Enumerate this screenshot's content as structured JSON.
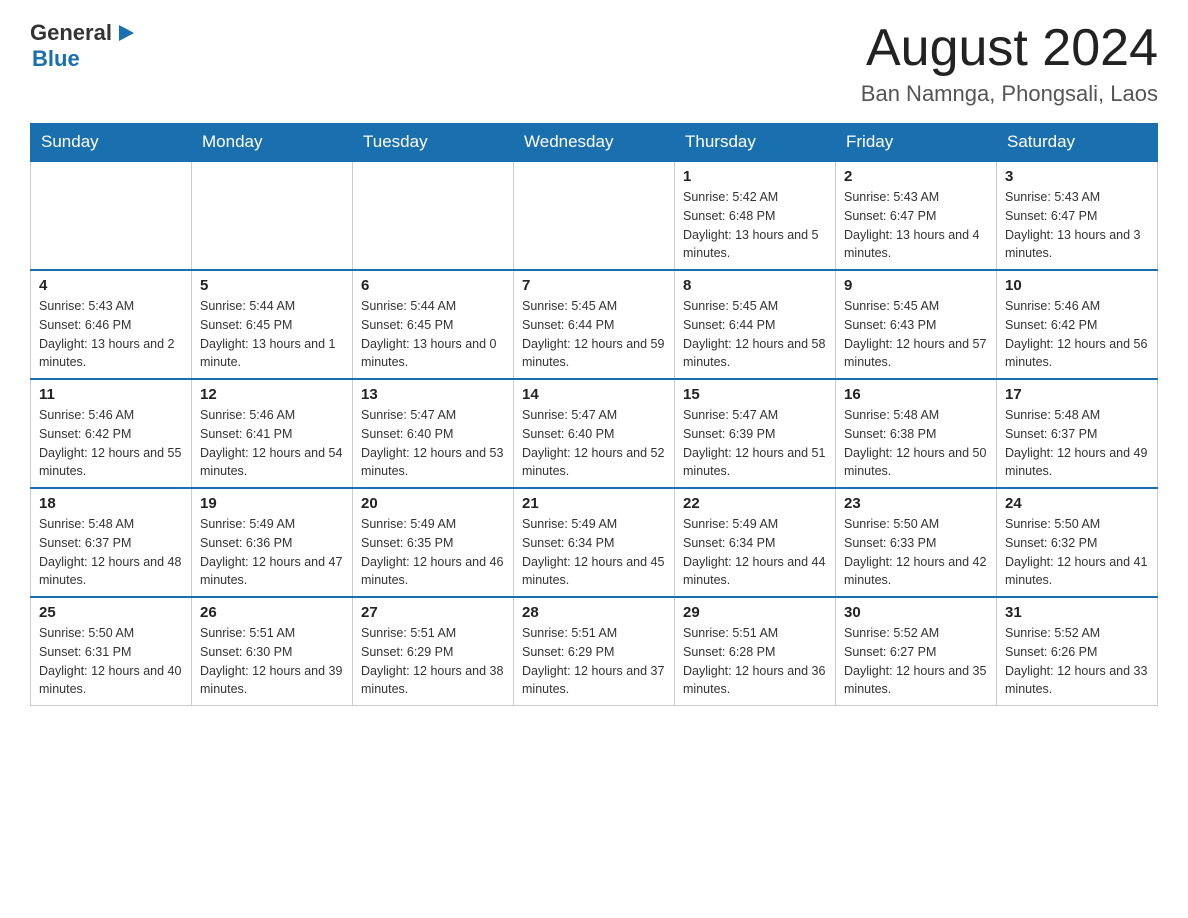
{
  "header": {
    "logo": {
      "general": "General",
      "blue": "Blue"
    },
    "title": "August 2024",
    "location": "Ban Namnga, Phongsali, Laos"
  },
  "days_of_week": [
    "Sunday",
    "Monday",
    "Tuesday",
    "Wednesday",
    "Thursday",
    "Friday",
    "Saturday"
  ],
  "weeks": [
    [
      {
        "day": "",
        "info": ""
      },
      {
        "day": "",
        "info": ""
      },
      {
        "day": "",
        "info": ""
      },
      {
        "day": "",
        "info": ""
      },
      {
        "day": "1",
        "info": "Sunrise: 5:42 AM\nSunset: 6:48 PM\nDaylight: 13 hours and 5 minutes."
      },
      {
        "day": "2",
        "info": "Sunrise: 5:43 AM\nSunset: 6:47 PM\nDaylight: 13 hours and 4 minutes."
      },
      {
        "day": "3",
        "info": "Sunrise: 5:43 AM\nSunset: 6:47 PM\nDaylight: 13 hours and 3 minutes."
      }
    ],
    [
      {
        "day": "4",
        "info": "Sunrise: 5:43 AM\nSunset: 6:46 PM\nDaylight: 13 hours and 2 minutes."
      },
      {
        "day": "5",
        "info": "Sunrise: 5:44 AM\nSunset: 6:45 PM\nDaylight: 13 hours and 1 minute."
      },
      {
        "day": "6",
        "info": "Sunrise: 5:44 AM\nSunset: 6:45 PM\nDaylight: 13 hours and 0 minutes."
      },
      {
        "day": "7",
        "info": "Sunrise: 5:45 AM\nSunset: 6:44 PM\nDaylight: 12 hours and 59 minutes."
      },
      {
        "day": "8",
        "info": "Sunrise: 5:45 AM\nSunset: 6:44 PM\nDaylight: 12 hours and 58 minutes."
      },
      {
        "day": "9",
        "info": "Sunrise: 5:45 AM\nSunset: 6:43 PM\nDaylight: 12 hours and 57 minutes."
      },
      {
        "day": "10",
        "info": "Sunrise: 5:46 AM\nSunset: 6:42 PM\nDaylight: 12 hours and 56 minutes."
      }
    ],
    [
      {
        "day": "11",
        "info": "Sunrise: 5:46 AM\nSunset: 6:42 PM\nDaylight: 12 hours and 55 minutes."
      },
      {
        "day": "12",
        "info": "Sunrise: 5:46 AM\nSunset: 6:41 PM\nDaylight: 12 hours and 54 minutes."
      },
      {
        "day": "13",
        "info": "Sunrise: 5:47 AM\nSunset: 6:40 PM\nDaylight: 12 hours and 53 minutes."
      },
      {
        "day": "14",
        "info": "Sunrise: 5:47 AM\nSunset: 6:40 PM\nDaylight: 12 hours and 52 minutes."
      },
      {
        "day": "15",
        "info": "Sunrise: 5:47 AM\nSunset: 6:39 PM\nDaylight: 12 hours and 51 minutes."
      },
      {
        "day": "16",
        "info": "Sunrise: 5:48 AM\nSunset: 6:38 PM\nDaylight: 12 hours and 50 minutes."
      },
      {
        "day": "17",
        "info": "Sunrise: 5:48 AM\nSunset: 6:37 PM\nDaylight: 12 hours and 49 minutes."
      }
    ],
    [
      {
        "day": "18",
        "info": "Sunrise: 5:48 AM\nSunset: 6:37 PM\nDaylight: 12 hours and 48 minutes."
      },
      {
        "day": "19",
        "info": "Sunrise: 5:49 AM\nSunset: 6:36 PM\nDaylight: 12 hours and 47 minutes."
      },
      {
        "day": "20",
        "info": "Sunrise: 5:49 AM\nSunset: 6:35 PM\nDaylight: 12 hours and 46 minutes."
      },
      {
        "day": "21",
        "info": "Sunrise: 5:49 AM\nSunset: 6:34 PM\nDaylight: 12 hours and 45 minutes."
      },
      {
        "day": "22",
        "info": "Sunrise: 5:49 AM\nSunset: 6:34 PM\nDaylight: 12 hours and 44 minutes."
      },
      {
        "day": "23",
        "info": "Sunrise: 5:50 AM\nSunset: 6:33 PM\nDaylight: 12 hours and 42 minutes."
      },
      {
        "day": "24",
        "info": "Sunrise: 5:50 AM\nSunset: 6:32 PM\nDaylight: 12 hours and 41 minutes."
      }
    ],
    [
      {
        "day": "25",
        "info": "Sunrise: 5:50 AM\nSunset: 6:31 PM\nDaylight: 12 hours and 40 minutes."
      },
      {
        "day": "26",
        "info": "Sunrise: 5:51 AM\nSunset: 6:30 PM\nDaylight: 12 hours and 39 minutes."
      },
      {
        "day": "27",
        "info": "Sunrise: 5:51 AM\nSunset: 6:29 PM\nDaylight: 12 hours and 38 minutes."
      },
      {
        "day": "28",
        "info": "Sunrise: 5:51 AM\nSunset: 6:29 PM\nDaylight: 12 hours and 37 minutes."
      },
      {
        "day": "29",
        "info": "Sunrise: 5:51 AM\nSunset: 6:28 PM\nDaylight: 12 hours and 36 minutes."
      },
      {
        "day": "30",
        "info": "Sunrise: 5:52 AM\nSunset: 6:27 PM\nDaylight: 12 hours and 35 minutes."
      },
      {
        "day": "31",
        "info": "Sunrise: 5:52 AM\nSunset: 6:26 PM\nDaylight: 12 hours and 33 minutes."
      }
    ]
  ]
}
